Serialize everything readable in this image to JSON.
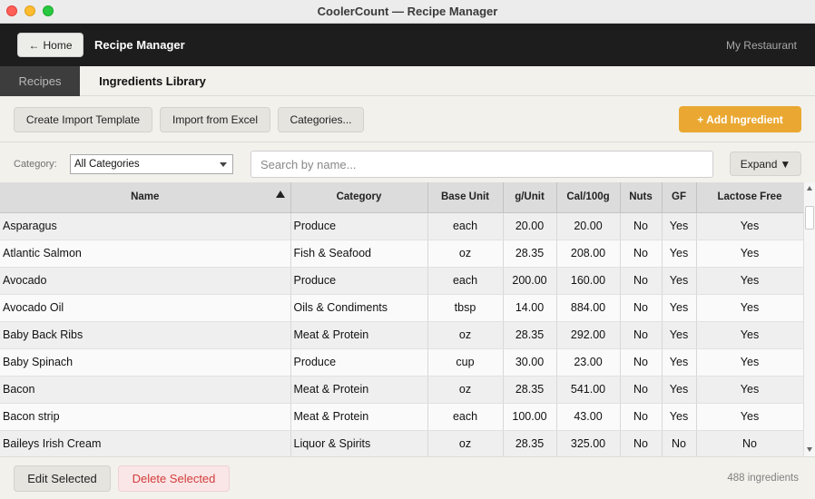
{
  "window": {
    "title": "CoolerCount — Recipe Manager"
  },
  "header": {
    "home_label": "Home",
    "title": "Recipe Manager",
    "restaurant": "My Restaurant"
  },
  "tabs": [
    {
      "label": "Recipes",
      "active": false
    },
    {
      "label": "Ingredients Library",
      "active": true
    }
  ],
  "toolbar": {
    "template_label": "Create Import Template",
    "import_label": "Import from Excel",
    "categories_label": "Categories...",
    "add_label": "+ Add Ingredient"
  },
  "filters": {
    "category_label": "Category:",
    "category_value": "All Categories",
    "search_placeholder": "Search by name...",
    "expand_label": "Expand",
    "expand_arrow": "▼"
  },
  "table": {
    "sort_column": "Name",
    "columns": [
      "Name",
      "Category",
      "Base Unit",
      "g/Unit",
      "Cal/100g",
      "Nuts",
      "GF",
      "Lactose Free"
    ],
    "rows": [
      [
        "Asparagus",
        "Produce",
        "each",
        "20.00",
        "20.00",
        "No",
        "Yes",
        "Yes"
      ],
      [
        "Atlantic Salmon",
        "Fish & Seafood",
        "oz",
        "28.35",
        "208.00",
        "No",
        "Yes",
        "Yes"
      ],
      [
        "Avocado",
        "Produce",
        "each",
        "200.00",
        "160.00",
        "No",
        "Yes",
        "Yes"
      ],
      [
        "Avocado Oil",
        "Oils & Condiments",
        "tbsp",
        "14.00",
        "884.00",
        "No",
        "Yes",
        "Yes"
      ],
      [
        "Baby Back Ribs",
        "Meat & Protein",
        "oz",
        "28.35",
        "292.00",
        "No",
        "Yes",
        "Yes"
      ],
      [
        "Baby Spinach",
        "Produce",
        "cup",
        "30.00",
        "23.00",
        "No",
        "Yes",
        "Yes"
      ],
      [
        "Bacon",
        "Meat & Protein",
        "oz",
        "28.35",
        "541.00",
        "No",
        "Yes",
        "Yes"
      ],
      [
        "Bacon strip",
        "Meat & Protein",
        "each",
        "100.00",
        "43.00",
        "No",
        "Yes",
        "Yes"
      ],
      [
        "Baileys Irish Cream",
        "Liquor & Spirits",
        "oz",
        "28.35",
        "325.00",
        "No",
        "No",
        "No"
      ]
    ]
  },
  "footer": {
    "edit_label": "Edit Selected",
    "delete_label": "Delete Selected",
    "count": "488 ingredients"
  },
  "colors": {
    "accent": "#eaa832",
    "header_bg": "#1d1d1d",
    "danger_text": "#d23c3c"
  }
}
